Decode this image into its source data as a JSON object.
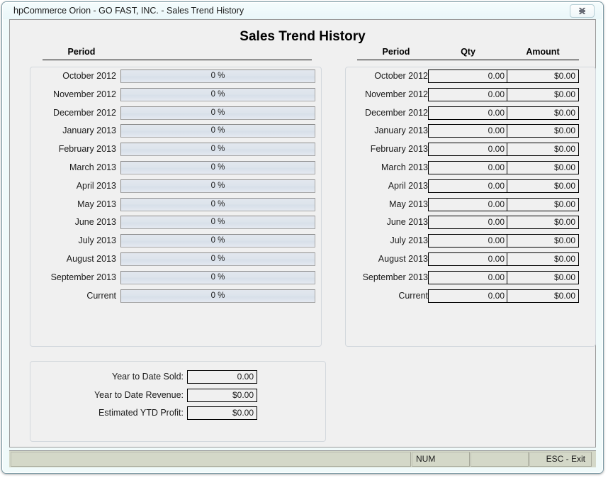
{
  "window": {
    "title": "hpCommerce Orion - GO FAST, INC. - Sales Trend History",
    "close_icon": "close-icon",
    "page_title": "Sales Trend History"
  },
  "trend_panel": {
    "header": "Period",
    "rows": [
      {
        "period": "October 2012",
        "percent": "0 %"
      },
      {
        "period": "November 2012",
        "percent": "0 %"
      },
      {
        "period": "December 2012",
        "percent": "0 %"
      },
      {
        "period": "January 2013",
        "percent": "0 %"
      },
      {
        "period": "February 2013",
        "percent": "0 %"
      },
      {
        "period": "March 2013",
        "percent": "0 %"
      },
      {
        "period": "April 2013",
        "percent": "0 %"
      },
      {
        "period": "May 2013",
        "percent": "0 %"
      },
      {
        "period": "June 2013",
        "percent": "0 %"
      },
      {
        "period": "July 2013",
        "percent": "0 %"
      },
      {
        "period": "August 2013",
        "percent": "0 %"
      },
      {
        "period": "September 2013",
        "percent": "0 %"
      },
      {
        "period": "Current",
        "percent": "0 %"
      }
    ]
  },
  "history_panel": {
    "headers": {
      "period": "Period",
      "qty": "Qty",
      "amount": "Amount"
    },
    "rows": [
      {
        "period": "October 2012",
        "qty": "0.00",
        "amount": "$0.00"
      },
      {
        "period": "November 2012",
        "qty": "0.00",
        "amount": "$0.00"
      },
      {
        "period": "December 2012",
        "qty": "0.00",
        "amount": "$0.00"
      },
      {
        "period": "January 2013",
        "qty": "0.00",
        "amount": "$0.00"
      },
      {
        "period": "February 2013",
        "qty": "0.00",
        "amount": "$0.00"
      },
      {
        "period": "March 2013",
        "qty": "0.00",
        "amount": "$0.00"
      },
      {
        "period": "April 2013",
        "qty": "0.00",
        "amount": "$0.00"
      },
      {
        "period": "May 2013",
        "qty": "0.00",
        "amount": "$0.00"
      },
      {
        "period": "June 2013",
        "qty": "0.00",
        "amount": "$0.00"
      },
      {
        "period": "July 2013",
        "qty": "0.00",
        "amount": "$0.00"
      },
      {
        "period": "August 2013",
        "qty": "0.00",
        "amount": "$0.00"
      },
      {
        "period": "September 2013",
        "qty": "0.00",
        "amount": "$0.00"
      },
      {
        "period": "Current",
        "qty": "0.00",
        "amount": "$0.00"
      }
    ]
  },
  "summary_panel": {
    "rows": [
      {
        "label": "Year to Date Sold:",
        "value": "0.00"
      },
      {
        "label": "Year to Date Revenue:",
        "value": "$0.00"
      },
      {
        "label": "Estimated YTD Profit:",
        "value": "$0.00"
      }
    ]
  },
  "status_bar": {
    "main": "",
    "num": "NUM",
    "blank": "",
    "esc": "ESC - Exit"
  }
}
